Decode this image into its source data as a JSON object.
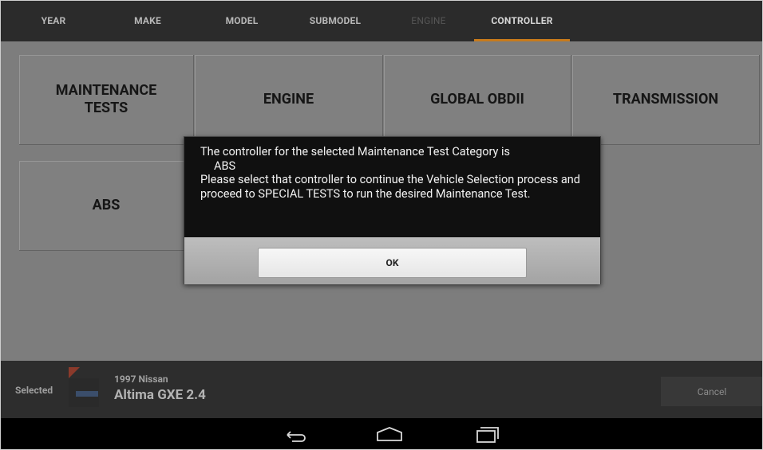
{
  "tabs": [
    {
      "label": "YEAR"
    },
    {
      "label": "MAKE"
    },
    {
      "label": "MODEL"
    },
    {
      "label": "SUBMODEL"
    },
    {
      "label": "ENGINE"
    },
    {
      "label": "CONTROLLER"
    }
  ],
  "tiles": [
    {
      "label": "MAINTENANCE TESTS"
    },
    {
      "label": "ENGINE"
    },
    {
      "label": "GLOBAL OBDII"
    },
    {
      "label": "TRANSMISSION"
    },
    {
      "label": "ABS"
    }
  ],
  "dialog": {
    "line1": "The controller for the selected Maintenance Test Category is",
    "controller": "ABS",
    "line2": "Please select that controller to continue the Vehicle Selection process and proceed to SPECIAL TESTS to run the desired Maintenance Test.",
    "ok_label": "OK"
  },
  "selected": {
    "label": "Selected",
    "vehicle_year_make": "1997 Nissan",
    "vehicle_model": "Altima GXE 2.4",
    "cancel_label": "Cancel"
  },
  "nav": {
    "back_icon": "back-icon",
    "home_icon": "home-icon",
    "recents_icon": "recents-icon"
  },
  "colors": {
    "active_tab_underline": "#c77a1c",
    "dialog_background": "#101010"
  }
}
